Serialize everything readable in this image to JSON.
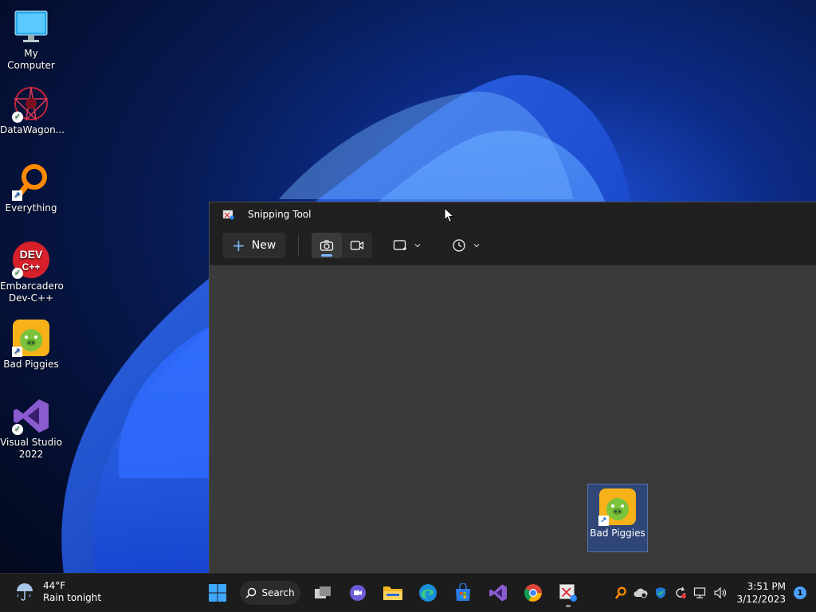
{
  "desktop": {
    "icons": [
      {
        "label": "My Computer"
      },
      {
        "label": "DataWagon..."
      },
      {
        "label": "Everything"
      },
      {
        "label": "Embarcadero Dev-C++"
      },
      {
        "label": "Bad Piggies"
      },
      {
        "label": "Visual Studio 2022"
      }
    ],
    "drag_ghost_label": "Bad Piggies"
  },
  "snipping_tool": {
    "title": "Snipping Tool",
    "new_label": "New",
    "modes": [
      "camera-icon",
      "video-icon"
    ],
    "active_mode": "camera-icon"
  },
  "taskbar": {
    "weather": {
      "temp": "44°F",
      "desc": "Rain tonight"
    },
    "search_label": "Search",
    "clock": {
      "time": "3:51 PM",
      "date": "3/12/2023"
    },
    "notification_count": "1"
  },
  "colors": {
    "accent": "#7eb8ff",
    "taskbar": "#1c1c1c",
    "window": "#202020",
    "canvas": "#3a3a3a"
  }
}
